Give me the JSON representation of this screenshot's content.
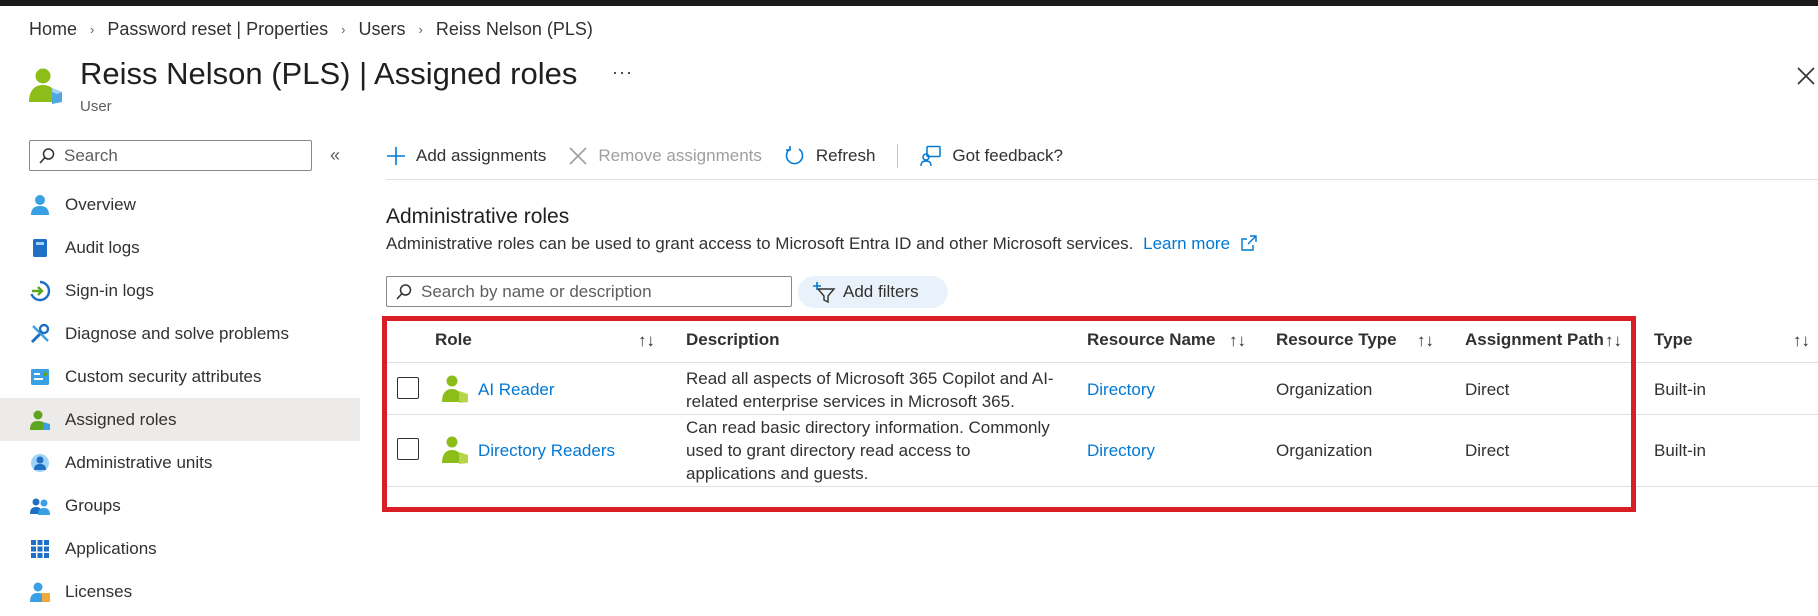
{
  "breadcrumb": [
    "Home",
    "Password reset | Properties",
    "Users",
    "Reiss Nelson (PLS)"
  ],
  "header": {
    "title": "Reiss Nelson (PLS) | Assigned roles",
    "subtitle": "User",
    "more": "···"
  },
  "sidebar": {
    "search_placeholder": "Search",
    "collapse": "«",
    "items": [
      {
        "label": "Overview",
        "icon": "user-icon"
      },
      {
        "label": "Audit logs",
        "icon": "book-icon"
      },
      {
        "label": "Sign-in logs",
        "icon": "sign-in-icon"
      },
      {
        "label": "Diagnose and solve problems",
        "icon": "wrench-icon"
      },
      {
        "label": "Custom security attributes",
        "icon": "attributes-icon"
      },
      {
        "label": "Assigned roles",
        "icon": "assigned-roles-icon",
        "active": true
      },
      {
        "label": "Administrative units",
        "icon": "admin-units-icon"
      },
      {
        "label": "Groups",
        "icon": "groups-icon"
      },
      {
        "label": "Applications",
        "icon": "apps-grid-icon"
      },
      {
        "label": "Licenses",
        "icon": "licenses-icon"
      }
    ]
  },
  "toolbar": {
    "add": "Add assignments",
    "remove": "Remove assignments",
    "refresh": "Refresh",
    "feedback": "Got feedback?"
  },
  "section": {
    "title": "Administrative roles",
    "description": "Administrative roles can be used to grant access to Microsoft Entra ID and other Microsoft services.",
    "learn_more": "Learn more"
  },
  "table": {
    "search_placeholder": "Search by name or description",
    "add_filters": "Add filters",
    "sort_glyph": "↑↓",
    "columns": {
      "role": "Role",
      "description": "Description",
      "resource_name": "Resource Name",
      "resource_type": "Resource Type",
      "assignment_path": "Assignment Path",
      "type": "Type"
    },
    "rows": [
      {
        "role": "AI Reader",
        "description_lines": [
          "Read all aspects of Microsoft 365 Copilot and AI-",
          "related enterprise services in Microsoft 365."
        ],
        "resource_name": "Directory",
        "resource_type": "Organization",
        "assignment_path": "Direct",
        "type": "Built-in"
      },
      {
        "role": "Directory Readers",
        "description_lines": [
          "Can read basic directory information. Commonly",
          "used to grant directory read access to",
          "applications and guests."
        ],
        "resource_name": "Directory",
        "resource_type": "Organization",
        "assignment_path": "Direct",
        "type": "Built-in"
      }
    ]
  },
  "colors": {
    "link": "#0078d4",
    "highlight": "#d91e25",
    "active_nav": "#edebe9"
  }
}
